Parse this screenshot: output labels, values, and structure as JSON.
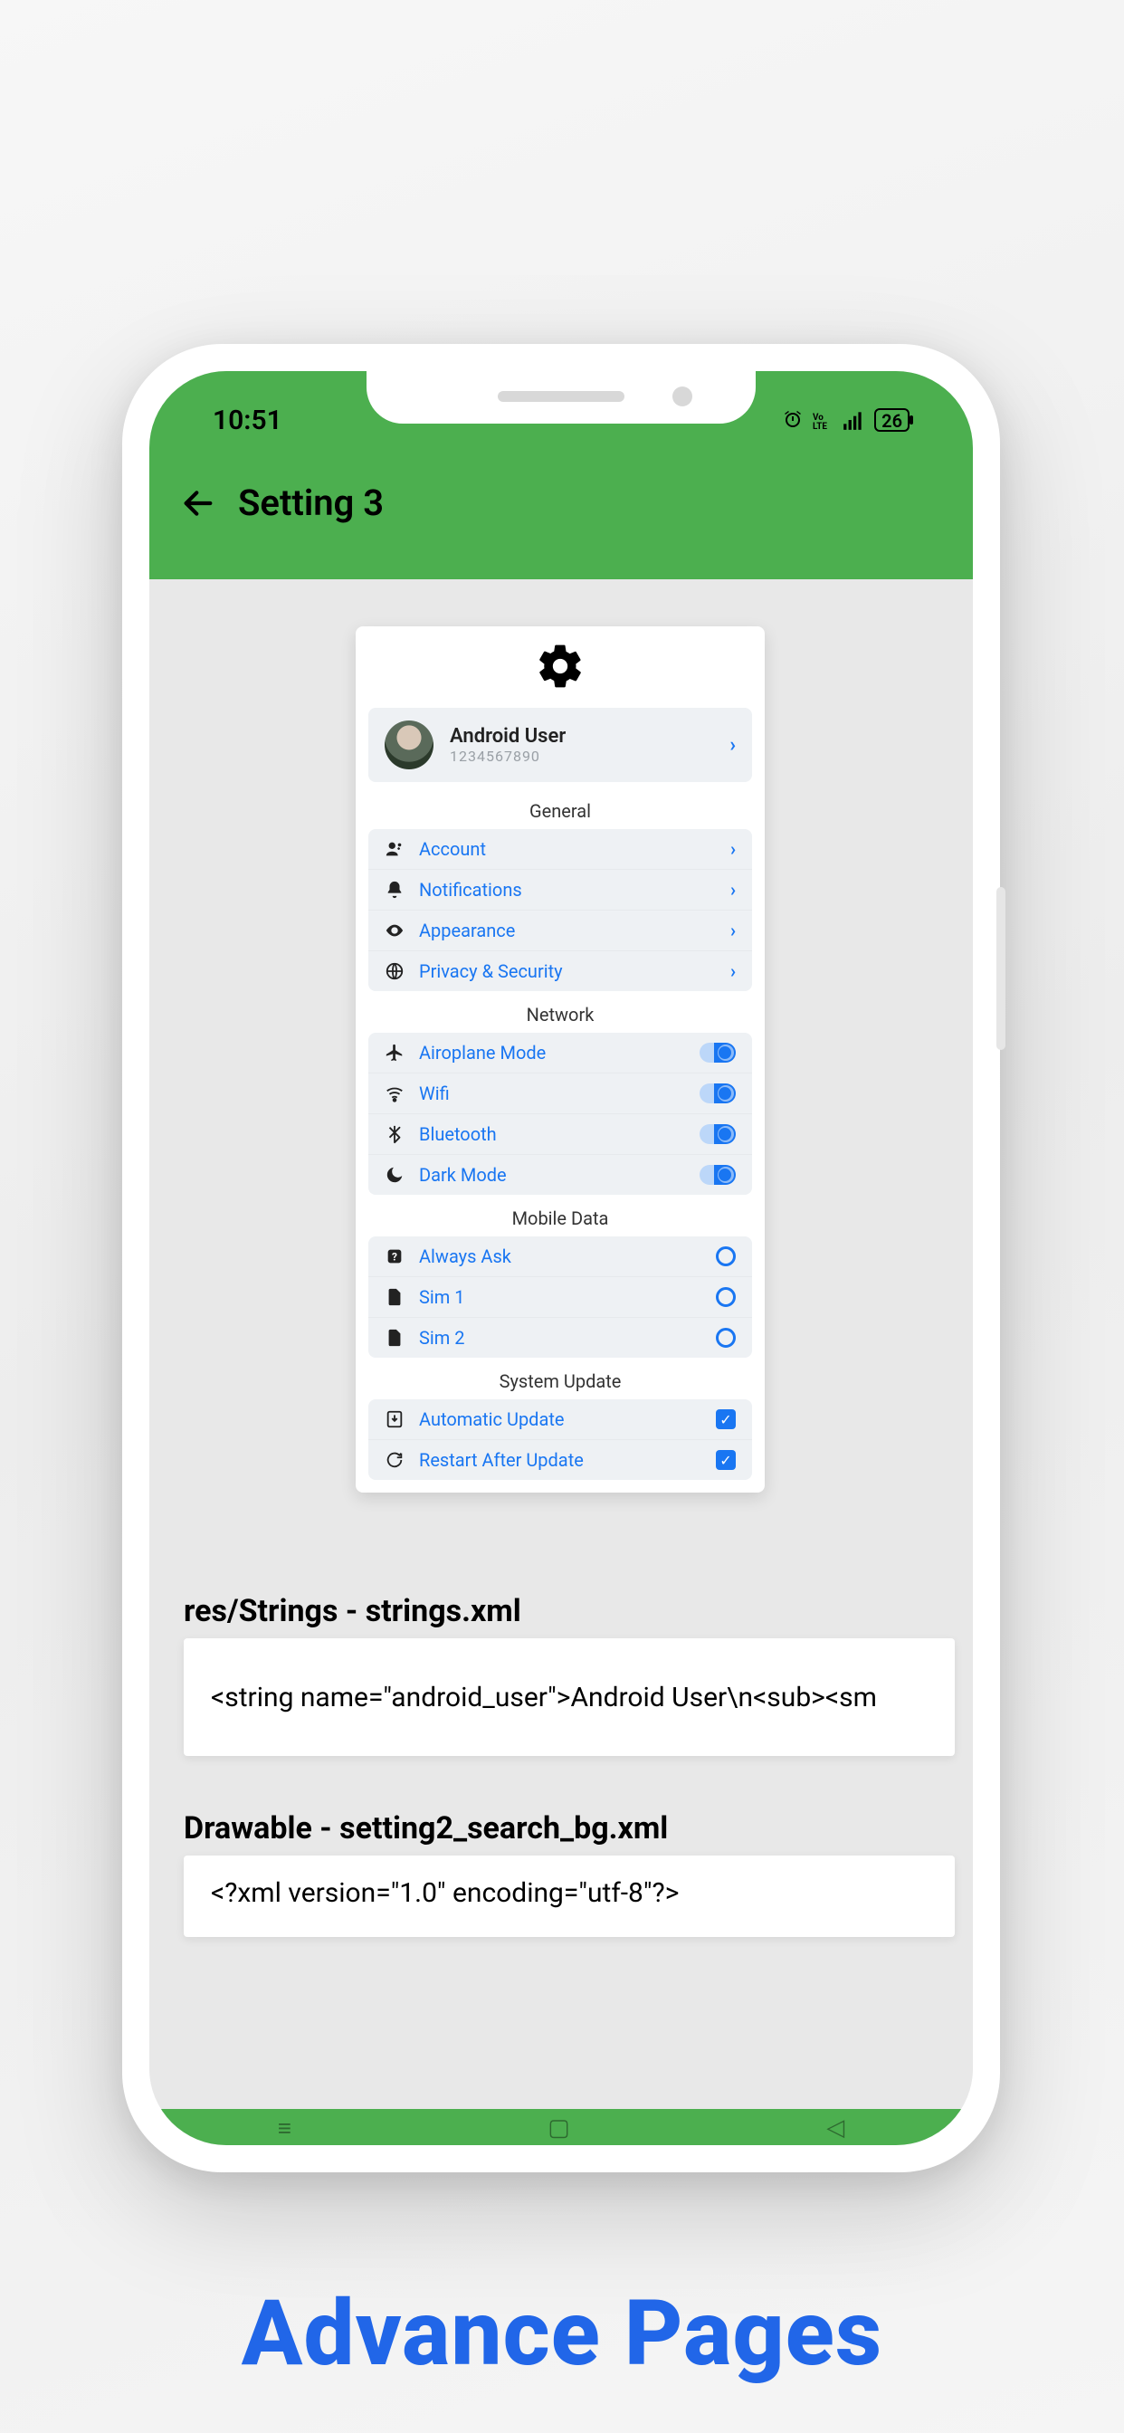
{
  "promo_text": "Advance Pages",
  "status": {
    "time": "10:51",
    "battery": "26"
  },
  "appbar": {
    "title": "Setting 3"
  },
  "profile": {
    "name": "Android User",
    "sub": "1234567890"
  },
  "sections": {
    "general": {
      "title": "General",
      "items": [
        "Account",
        "Notifications",
        "Appearance",
        "Privacy & Security"
      ]
    },
    "network": {
      "title": "Network",
      "items": [
        "Airoplane Mode",
        "Wifi",
        "Bluetooth",
        "Dark Mode"
      ]
    },
    "mobile": {
      "title": "Mobile Data",
      "items": [
        "Always Ask",
        "Sim 1",
        "Sim 2"
      ]
    },
    "update": {
      "title": "System Update",
      "items": [
        "Automatic Update",
        "Restart After Update"
      ]
    }
  },
  "code": {
    "h1": "res/Strings - strings.xml",
    "c1": "<string name=\"android_user\">Android User\\n<sub><sm",
    "h2": "Drawable - setting2_search_bg.xml",
    "c2": "<?xml version=\"1.0\" encoding=\"utf-8\"?>"
  }
}
